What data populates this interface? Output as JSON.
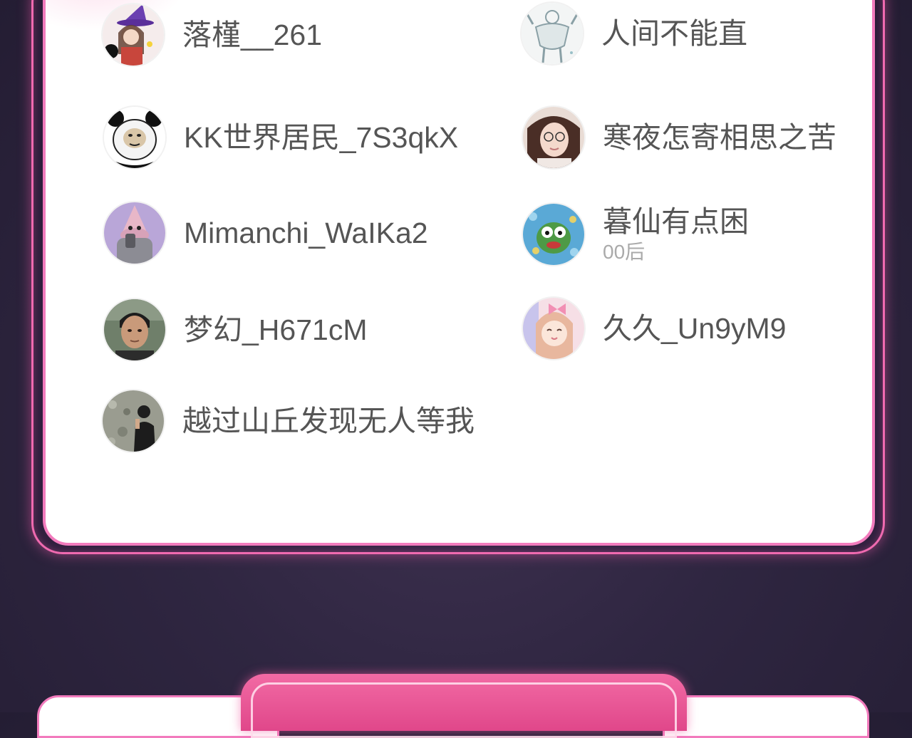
{
  "members": [
    {
      "name": "落槿__261",
      "tag": null,
      "avatar": "witch-couple-avatar-icon"
    },
    {
      "name": "人间不能直",
      "tag": null,
      "avatar": "muscle-sketch-avatar-icon"
    },
    {
      "name": "KK世界居民_7S3qkX",
      "tag": null,
      "avatar": "panda-meme-avatar-icon"
    },
    {
      "name": "寒夜怎寄相思之苦",
      "tag": null,
      "avatar": "girl-glasses-avatar-icon"
    },
    {
      "name": "Mimanchi_WaIKa2",
      "tag": null,
      "avatar": "purple-cartoon-avatar-icon"
    },
    {
      "name": "暮仙有点困",
      "tag": "00后",
      "avatar": "green-frog-avatar-icon"
    },
    {
      "name": "梦幻_H671cM",
      "tag": null,
      "avatar": "man-portrait-avatar-icon"
    },
    {
      "name": "久久_Un9yM9",
      "tag": null,
      "avatar": "anime-girl-avatar-icon"
    },
    {
      "name": "越过山丘发现无人等我",
      "tag": null,
      "avatar": "rocks-person-avatar-icon"
    }
  ],
  "bottom_section": {
    "title": "",
    "accent_color": "#e0478a",
    "border_color": "#f27bbd"
  }
}
